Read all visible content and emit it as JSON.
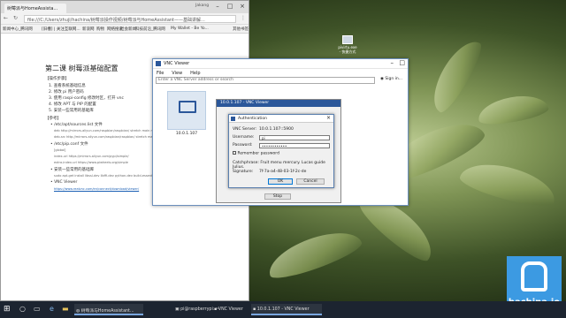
{
  "browser": {
    "tab_title": "树莓派与HomeAssista...",
    "user_label": "Jakang",
    "url": "file:///C:/Users/zhuji/hachina/树莓派操作视频/树莓派与HomeAssistant——基础讲解...",
    "bookmarks": [
      "新闻中心_腾讯网",
      "[旧槽] | 关注互联网...",
      "新浪网",
      "购物",
      "网络搜索",
      "社会新闻",
      "科技前沿_腾讯网",
      "My Wallet - Be Yo...",
      "其他书签"
    ],
    "page": {
      "heading": "第二课 树莓派基础配置",
      "steps_title": "【操作步骤】",
      "steps": [
        "1.   查看系统基础信息",
        "2.   修改 pi 用户密码",
        "3.   使用 raspi-config 修改时区，打开 vnc",
        "4.   修改 APT 与 PIP 的配置",
        "5.   安装一些常用的基础库"
      ],
      "ref_title": "【参考】",
      "refs": [
        {
          "title": "/etc/apt/sources.list 文件",
          "lines": [
            "deb http://mirrors.aliyun.com/raspbian/raspbian/ stretch main non-free contrib rpi",
            "deb-src http://mirrors.aliyun.com/raspbian/raspbian/ stretch main non-free contrib rpi"
          ]
        },
        {
          "title": "/etc/pip.conf 文件",
          "lines": [
            "[global]",
            "index-url https://mirrors.aliyun.com/pypi/simple/",
            "extra-index-url https://www.piwheels.org/simple"
          ]
        },
        {
          "title": "安装一些常用的基础库",
          "lines": [
            "sudo apt-get install libssl-dev libffi-dev python-dev build-essential libxml2-dev libxslt1-dev zlib1g-dev python3-pip"
          ]
        },
        {
          "title": "VNC Viewer",
          "lines": [
            "https://www.realvnc.com/en/connect/download/viewer/"
          ]
        }
      ]
    }
  },
  "vnc": {
    "title": "VNC Viewer",
    "menu": [
      "File",
      "View",
      "Help"
    ],
    "search_placeholder": "Enter a VNC Server address or search",
    "sign_in": "Sign in...",
    "tile_label": "10.0.1.107"
  },
  "viewer": {
    "title": "10.0.1.107 - VNC Viewer",
    "stop": "Stop"
  },
  "auth": {
    "title": "Authentication",
    "server_label": "VNC Server:",
    "server_value": "10.0.1.107::5900",
    "username_label": "Username:",
    "username_value": "pi",
    "password_label": "Password:",
    "password_value": "••••••••••••",
    "remember": "Remember password",
    "catchphrase": "Catchphrase: Fruit menu mercury. Lucas guide Julius.",
    "signature_label": "Signature:",
    "signature_value": "7f-7a-a4-48-03-1f-2c-de",
    "ok": "OK",
    "cancel": "Cancel"
  },
  "desktop_icon": "pivirtu.exe - 快捷方式",
  "taskbar": {
    "items": [
      "树莓派与HomeAssistant...",
      "pi@raspberrypi: ~",
      "VNC Viewer",
      "10.0.1.107 - VNC Viewer"
    ]
  },
  "logo": {
    "text": "hachina.io",
    "color": "#3c9ae2"
  }
}
